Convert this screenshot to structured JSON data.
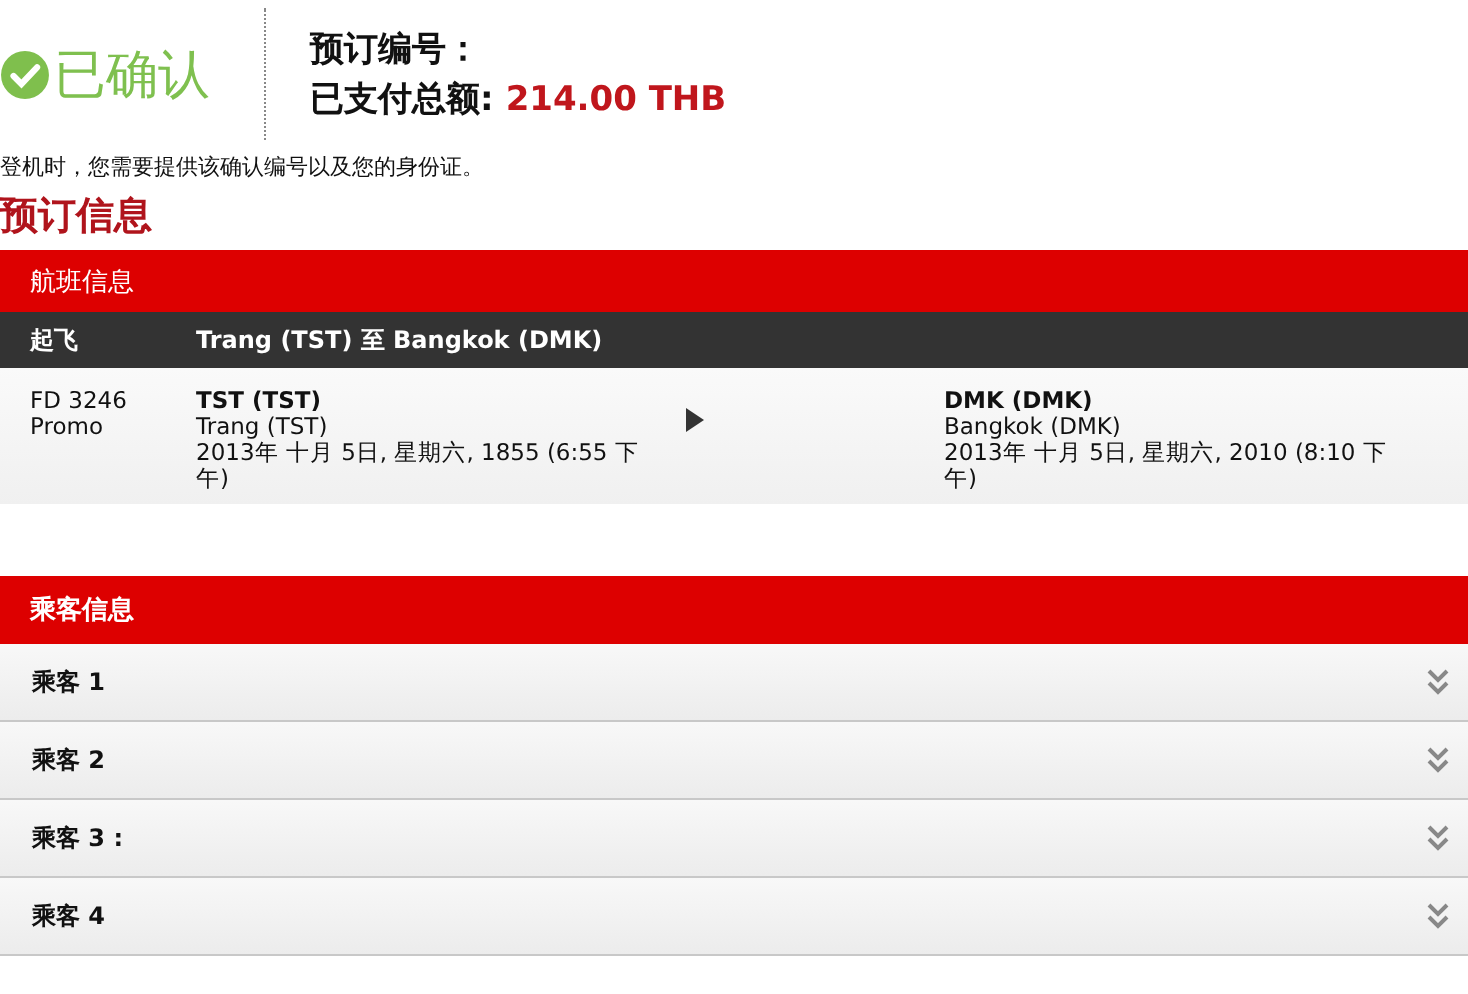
{
  "status": {
    "label": "已确认"
  },
  "summary": {
    "booking_number_label": "预订编号：",
    "total_label": "已支付总额:",
    "total_value": "214.00 THB"
  },
  "notice": "登机时，您需要提供该确认编号以及您的身份证。",
  "booking_title": "预订信息",
  "flight_section": {
    "title": "航班信息",
    "header": {
      "label": "起飞",
      "route": "Trang (TST) 至 Bangkok (DMK)"
    },
    "flight": {
      "number": "FD 3246",
      "fare": "Promo",
      "departure": {
        "code": "TST (TST)",
        "city": "Trang (TST)",
        "time": "2013年 十月 5日, 星期六, 1855 (6:55 下午)"
      },
      "arrival": {
        "code": "DMK (DMK)",
        "city": "Bangkok (DMK)",
        "time": "2013年 十月 5日, 星期六, 2010 (8:10 下午)"
      }
    }
  },
  "passenger_section": {
    "title": "乘客信息",
    "passengers": [
      {
        "label": "乘客 1",
        "expanded": false
      },
      {
        "label": "乘客 2",
        "expanded": false
      },
      {
        "label": "乘客 3 :",
        "expanded": false
      },
      {
        "label": "乘客 4",
        "expanded": false
      }
    ]
  }
}
